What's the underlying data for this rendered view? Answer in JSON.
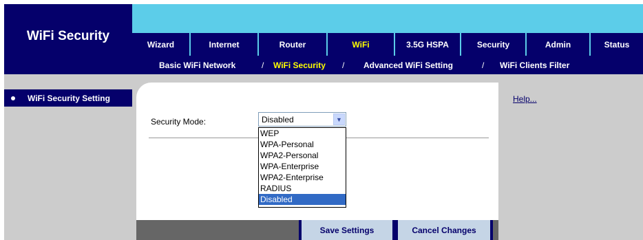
{
  "app": {
    "section_title": "WiFi Security"
  },
  "tabs": [
    {
      "label": "Wizard"
    },
    {
      "label": "Internet"
    },
    {
      "label": "Router"
    },
    {
      "label": "WiFi"
    },
    {
      "label": "3.5G HSPA"
    },
    {
      "label": "Security"
    },
    {
      "label": "Admin"
    },
    {
      "label": "Status"
    }
  ],
  "subnav": {
    "items": [
      {
        "label": "Basic WiFi Network"
      },
      {
        "label": "WiFi Security"
      },
      {
        "label": "Advanced WiFi Setting"
      },
      {
        "label": "WiFi Clients Filter"
      }
    ],
    "separator": "/"
  },
  "sidebar": {
    "active_item": "WiFi Security Setting"
  },
  "form": {
    "security_mode_label": "Security Mode:",
    "security_mode_value": "Disabled",
    "options": [
      "WEP",
      "WPA-Personal",
      "WPA2-Personal",
      "WPA-Enterprise",
      "WPA2-Enterprise",
      "RADIUS",
      "Disabled"
    ]
  },
  "buttons": {
    "save": "Save Settings",
    "cancel": "Cancel Changes"
  },
  "help": {
    "link": "Help..."
  },
  "colors": {
    "navy": "#05006b",
    "header_blue": "#5ccde9",
    "gray": "#cccccc",
    "active_yellow": "#ffff00",
    "select_highlight": "#316ac5"
  }
}
